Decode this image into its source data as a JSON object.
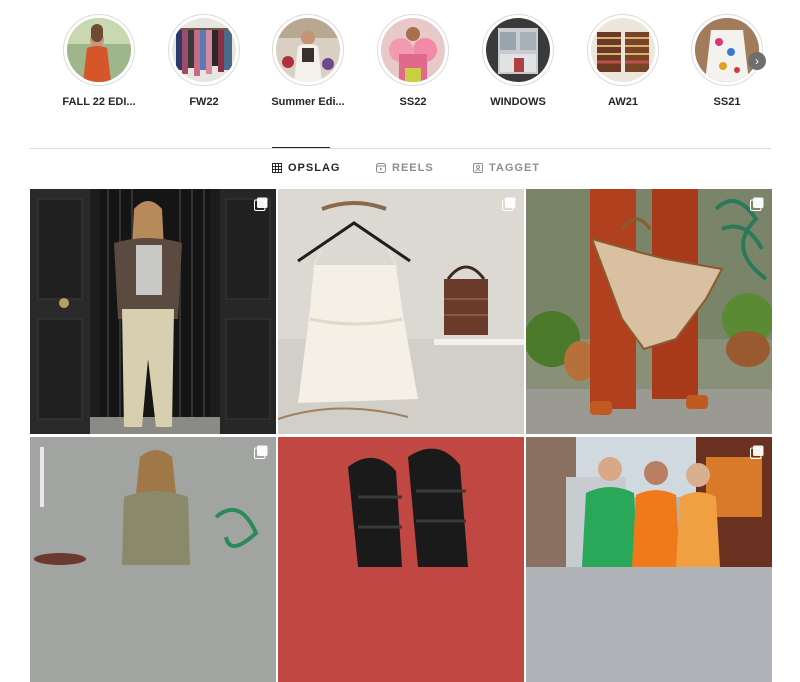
{
  "highlights": [
    {
      "label": "FALL 22 EDI..."
    },
    {
      "label": "FW22"
    },
    {
      "label": "Summer Edi..."
    },
    {
      "label": "SS22"
    },
    {
      "label": "WINDOWS"
    },
    {
      "label": "AW21"
    },
    {
      "label": "SS21"
    }
  ],
  "tabs": {
    "posts": "OPSLAG",
    "reels": "REELS",
    "tagged": "TAGGET"
  },
  "colors": {
    "divider": "#dbdbdb",
    "text": "#262626",
    "muted": "#8e8e8e"
  }
}
